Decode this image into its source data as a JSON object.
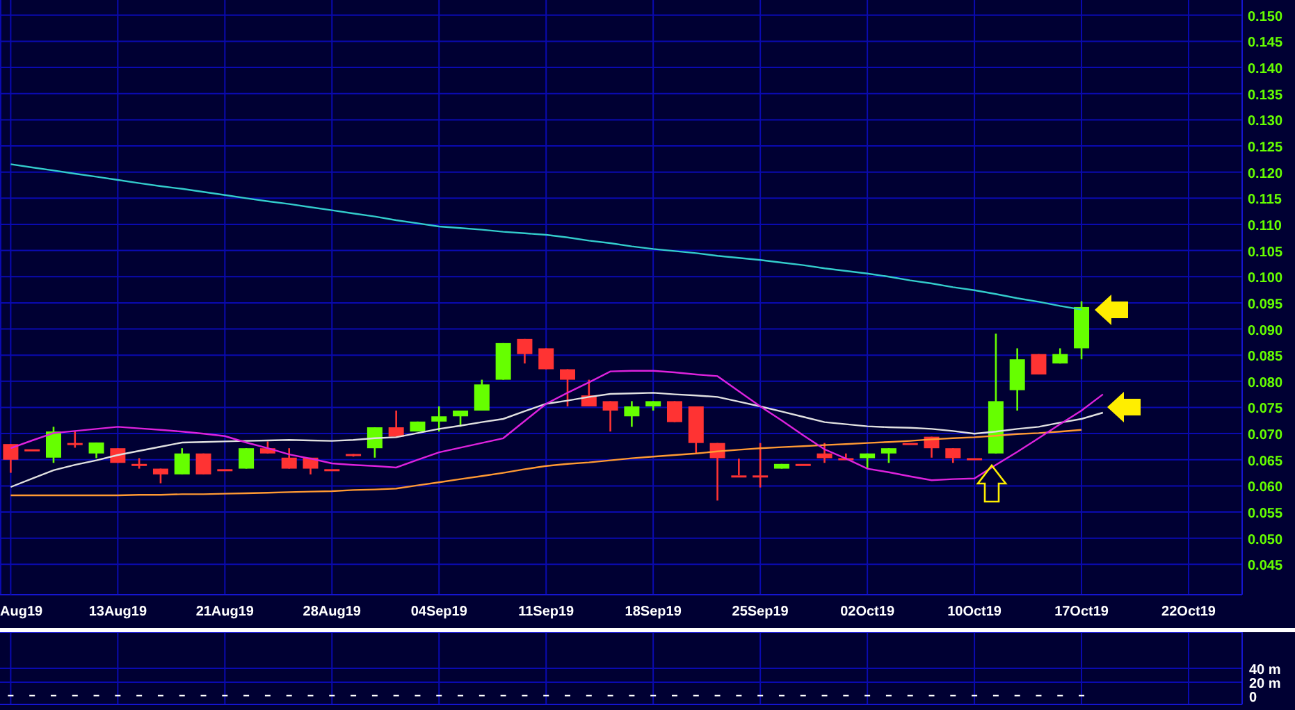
{
  "price_chart": {
    "clipped_date_label": "Aug19",
    "chart_data": {
      "type": "candlestick",
      "categories": [
        null,
        null,
        null,
        null,
        null,
        "13Aug19",
        null,
        null,
        null,
        null,
        "21Aug19",
        null,
        null,
        null,
        null,
        "28Aug19",
        null,
        null,
        null,
        null,
        "04Sep19",
        null,
        null,
        null,
        null,
        "11Sep19",
        null,
        null,
        null,
        null,
        "18Sep19",
        null,
        null,
        null,
        null,
        "25Sep19",
        null,
        null,
        null,
        null,
        "02Oct19",
        null,
        null,
        null,
        null,
        "10Oct19",
        null,
        null,
        null,
        null,
        "17Oct19",
        null,
        null,
        null,
        null,
        "22Oct19",
        null,
        null
      ],
      "ohlc": [
        [
          0.068,
          0.068,
          0.0625,
          0.065
        ],
        [
          0.067,
          0.067,
          0.067,
          0.067
        ],
        [
          0.0654,
          0.0713,
          0.0644,
          0.0704
        ],
        [
          0.0682,
          0.0704,
          0.0673,
          0.0682
        ],
        [
          0.0662,
          0.0683,
          0.0653,
          0.0683
        ],
        [
          0.0672,
          0.0672,
          0.0644,
          0.0644
        ],
        [
          0.0642,
          0.0653,
          0.0633,
          0.0642
        ],
        [
          0.0633,
          0.0633,
          0.0605,
          0.0622
        ],
        [
          0.0622,
          0.0672,
          0.0622,
          0.0662
        ],
        [
          0.0662,
          0.0662,
          0.0622,
          0.0622
        ],
        [
          0.0632,
          0.0632,
          0.0632,
          0.0632
        ],
        [
          0.0633,
          0.0672,
          0.0633,
          0.0672
        ],
        [
          0.0672,
          0.0685,
          0.0662,
          0.0662
        ],
        [
          0.0654,
          0.0672,
          0.0633,
          0.0633
        ],
        [
          0.0654,
          0.0654,
          0.0622,
          0.0633
        ],
        [
          0.0632,
          0.0632,
          0.0632,
          0.0632
        ],
        [
          0.0661,
          0.0661,
          0.0656,
          0.0661
        ],
        [
          0.0672,
          0.0712,
          0.0654,
          0.0712
        ],
        [
          0.0712,
          0.0744,
          0.0694,
          0.0694
        ],
        [
          0.0704,
          0.0723,
          0.0704,
          0.0723
        ],
        [
          0.0723,
          0.0752,
          0.0704,
          0.0733
        ],
        [
          0.0733,
          0.0744,
          0.0713,
          0.0744
        ],
        [
          0.0744,
          0.0803,
          0.0744,
          0.0794
        ],
        [
          0.0803,
          0.0873,
          0.0803,
          0.0873
        ],
        [
          0.0881,
          0.0881,
          0.0834,
          0.0852
        ],
        [
          0.0863,
          0.0863,
          0.0823,
          0.0823
        ],
        [
          0.0823,
          0.0823,
          0.0752,
          0.0803
        ],
        [
          0.0773,
          0.0803,
          0.0752,
          0.0752
        ],
        [
          0.0762,
          0.0762,
          0.0704,
          0.0744
        ],
        [
          0.0733,
          0.0762,
          0.0713,
          0.0752
        ],
        [
          0.0752,
          0.0762,
          0.0744,
          0.0762
        ],
        [
          0.0762,
          0.0762,
          0.0722,
          0.0722
        ],
        [
          0.0752,
          0.0752,
          0.0662,
          0.0682
        ],
        [
          0.0682,
          0.0682,
          0.0572,
          0.0653
        ],
        [
          0.062,
          0.0652,
          0.062,
          0.062
        ],
        [
          0.062,
          0.0682,
          0.0597,
          0.062
        ],
        [
          0.0633,
          0.0642,
          0.0633,
          0.0642
        ],
        [
          0.0642,
          0.0642,
          0.0642,
          0.0642
        ],
        [
          0.0662,
          0.0682,
          0.0644,
          0.0653
        ],
        [
          0.0653,
          0.0662,
          0.0653,
          0.0653
        ],
        [
          0.0653,
          0.0662,
          0.0633,
          0.0662
        ],
        [
          0.0662,
          0.0672,
          0.0644,
          0.0672
        ],
        [
          0.0682,
          0.0682,
          0.0682,
          0.0682
        ],
        [
          0.0694,
          0.0694,
          0.0654,
          0.0672
        ],
        [
          0.0672,
          0.0672,
          0.0644,
          0.0653
        ],
        [
          0.0653,
          0.0653,
          0.0653,
          0.0653
        ],
        [
          0.0662,
          0.0891,
          0.0662,
          0.0762
        ],
        [
          0.0783,
          0.0863,
          0.0744,
          0.0842
        ],
        [
          0.0852,
          0.0852,
          0.0813,
          0.0813
        ],
        [
          0.0834,
          0.0863,
          0.0834,
          0.0852
        ],
        [
          0.0863,
          0.0953,
          0.0842,
          0.0942
        ],
        null,
        null,
        null,
        null,
        null,
        null,
        null
      ],
      "series": [
        {
          "type": "line",
          "color": "#33cccc",
          "values": [
            0.1215,
            0.1209,
            0.1203,
            0.1197,
            0.1191,
            0.1185,
            0.1179,
            0.1173,
            0.1168,
            0.1162,
            0.1156,
            0.115,
            0.1144,
            0.1139,
            0.1133,
            0.1127,
            0.1121,
            0.1115,
            0.1108,
            0.1102,
            0.1096,
            0.1093,
            0.109,
            0.1086,
            0.1083,
            0.108,
            0.1075,
            0.1069,
            0.1064,
            0.1058,
            0.1053,
            0.1049,
            0.1045,
            0.104,
            0.1036,
            0.1032,
            0.1027,
            0.1022,
            0.1016,
            0.1011,
            0.1006,
            0.1,
            0.0993,
            0.0987,
            0.098,
            0.0974,
            0.0967,
            0.0959,
            0.0952,
            0.0944,
            0.0937,
            null,
            null,
            null,
            null,
            null,
            null,
            null
          ]
        },
        {
          "type": "line",
          "color": "#ff9933",
          "values": [
            0.0582,
            0.0582,
            0.0582,
            0.0582,
            0.0582,
            0.0582,
            0.0583,
            0.0583,
            0.0584,
            0.0584,
            0.0585,
            0.0586,
            0.0587,
            0.0588,
            0.0589,
            0.059,
            0.0592,
            0.0593,
            0.0595,
            0.0601,
            0.0607,
            0.0613,
            0.0619,
            0.0625,
            0.0632,
            0.0638,
            0.0642,
            0.0645,
            0.0649,
            0.0653,
            0.0656,
            0.0659,
            0.0662,
            0.0666,
            0.0669,
            0.0672,
            0.0674,
            0.0676,
            0.0678,
            0.068,
            0.0682,
            0.0684,
            0.0686,
            0.0689,
            0.0691,
            0.0693,
            0.0696,
            0.0699,
            0.0701,
            0.0704,
            0.0707,
            null,
            null,
            null,
            null,
            null,
            null,
            null
          ]
        },
        {
          "type": "line",
          "color": "#e0e0e0",
          "values": [
            0.0598,
            0.0614,
            0.063,
            0.064,
            0.0649,
            0.0659,
            0.0667,
            0.0675,
            0.0683,
            0.0684,
            0.0685,
            0.0686,
            0.0687,
            0.0688,
            0.0687,
            0.0686,
            0.0688,
            0.0691,
            0.0693,
            0.0701,
            0.0709,
            0.0715,
            0.0722,
            0.0728,
            0.0743,
            0.0757,
            0.0763,
            0.077,
            0.0776,
            0.0777,
            0.0778,
            0.0775,
            0.0773,
            0.077,
            0.0761,
            0.0752,
            0.0742,
            0.0732,
            0.0722,
            0.0718,
            0.0714,
            0.0712,
            0.0711,
            0.0709,
            0.0705,
            0.07,
            0.0704,
            0.0709,
            0.0713,
            0.0721,
            0.0728,
            0.074,
            null,
            null,
            null,
            null,
            null,
            null
          ]
        },
        {
          "type": "line",
          "color": "#dd22dd",
          "values": [
            0.0672,
            0.0687,
            0.0701,
            0.0705,
            0.0709,
            0.0713,
            0.071,
            0.0707,
            0.0704,
            0.07,
            0.0695,
            0.0683,
            0.0672,
            0.066,
            0.0652,
            0.0643,
            0.064,
            0.0638,
            0.0635,
            0.065,
            0.0664,
            0.0673,
            0.0682,
            0.0691,
            0.0724,
            0.0757,
            0.0778,
            0.0798,
            0.0819,
            0.082,
            0.082,
            0.0817,
            0.0813,
            0.081,
            0.0781,
            0.0752,
            0.0725,
            0.0697,
            0.067,
            0.0652,
            0.0633,
            0.0626,
            0.0618,
            0.0611,
            0.0613,
            0.0614,
            0.064,
            0.0665,
            0.0691,
            0.0718,
            0.0744,
            0.0775,
            null,
            null,
            null,
            null,
            null,
            null
          ]
        }
      ],
      "grid": true,
      "ylim": [
        0.0392,
        0.1529
      ],
      "yticks": [
        {
          "value": 0.15,
          "label": "0.150"
        },
        {
          "value": 0.145,
          "label": "0.145"
        },
        {
          "value": 0.14,
          "label": "0.140"
        },
        {
          "value": 0.135,
          "label": "0.135"
        },
        {
          "value": 0.13,
          "label": "0.130"
        },
        {
          "value": 0.125,
          "label": "0.125"
        },
        {
          "value": 0.12,
          "label": "0.120"
        },
        {
          "value": 0.115,
          "label": "0.115"
        },
        {
          "value": 0.11,
          "label": "0.110"
        },
        {
          "value": 0.105,
          "label": "0.105"
        },
        {
          "value": 0.1,
          "label": "0.100"
        },
        {
          "value": 0.095,
          "label": "0.095"
        },
        {
          "value": 0.09,
          "label": "0.090"
        },
        {
          "value": 0.085,
          "label": "0.085"
        },
        {
          "value": 0.08,
          "label": "0.080"
        },
        {
          "value": 0.075,
          "label": "0.075"
        },
        {
          "value": 0.07,
          "label": "0.070"
        },
        {
          "value": 0.065,
          "label": "0.065"
        },
        {
          "value": 0.06,
          "label": "0.060"
        },
        {
          "value": 0.055,
          "label": "0.055"
        },
        {
          "value": 0.05,
          "label": "0.050"
        },
        {
          "value": 0.045,
          "label": "0.045"
        }
      ]
    }
  },
  "volume_panel": {
    "labels": [
      "40 m",
      "20 m",
      "0"
    ]
  }
}
